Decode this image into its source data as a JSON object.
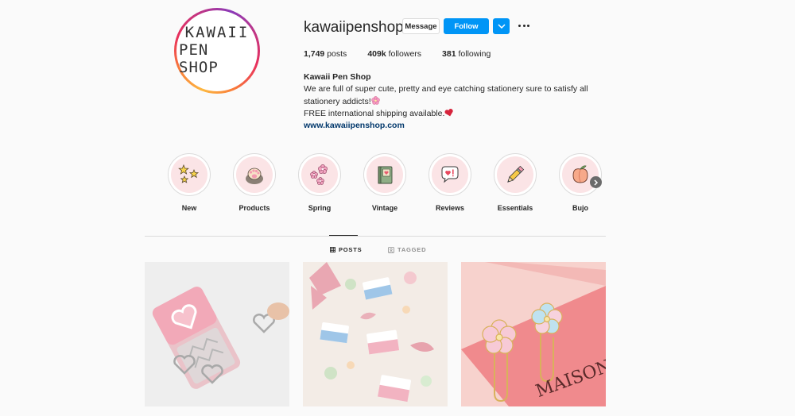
{
  "profile": {
    "logo_line1": "KAWAII",
    "logo_line2": "PEN SHOP",
    "username": "kawaiipenshop",
    "message_label": "Message",
    "follow_label": "Follow",
    "stats": {
      "posts_count": "1,749",
      "posts_label": "posts",
      "followers_count": "409k",
      "followers_label": "followers",
      "following_count": "381",
      "following_label": "following"
    },
    "bio": {
      "name": "Kawaii Pen Shop",
      "line1": "We are full of super cute, pretty and eye catching stationery sure to satisfy all",
      "line2": "stationery addicts!",
      "line3": "FREE international shipping available.",
      "link": "www.kawaiipenshop.com"
    }
  },
  "highlights": [
    {
      "label": "New",
      "icon": "stars-icon"
    },
    {
      "label": "Products",
      "icon": "paw-icon"
    },
    {
      "label": "Spring",
      "icon": "blossom-icon"
    },
    {
      "label": "Vintage",
      "icon": "book-icon"
    },
    {
      "label": "Reviews",
      "icon": "speech-heart-icon"
    },
    {
      "label": "Essentials",
      "icon": "pencil-icon"
    },
    {
      "label": "Bujo",
      "icon": "peach-icon"
    }
  ],
  "tabs": {
    "posts_label": "POSTS",
    "tagged_label": "TAGGED"
  },
  "posts": [
    {
      "icon": "heart-clips-photo"
    },
    {
      "icon": "sakura-erasers-photo"
    },
    {
      "icon": "flower-clips-photo",
      "caption_text": "MAISON"
    }
  ],
  "colors": {
    "follow_blue": "#0095f6",
    "link": "#00376b",
    "highlight_bg": "#fbe4e6"
  }
}
